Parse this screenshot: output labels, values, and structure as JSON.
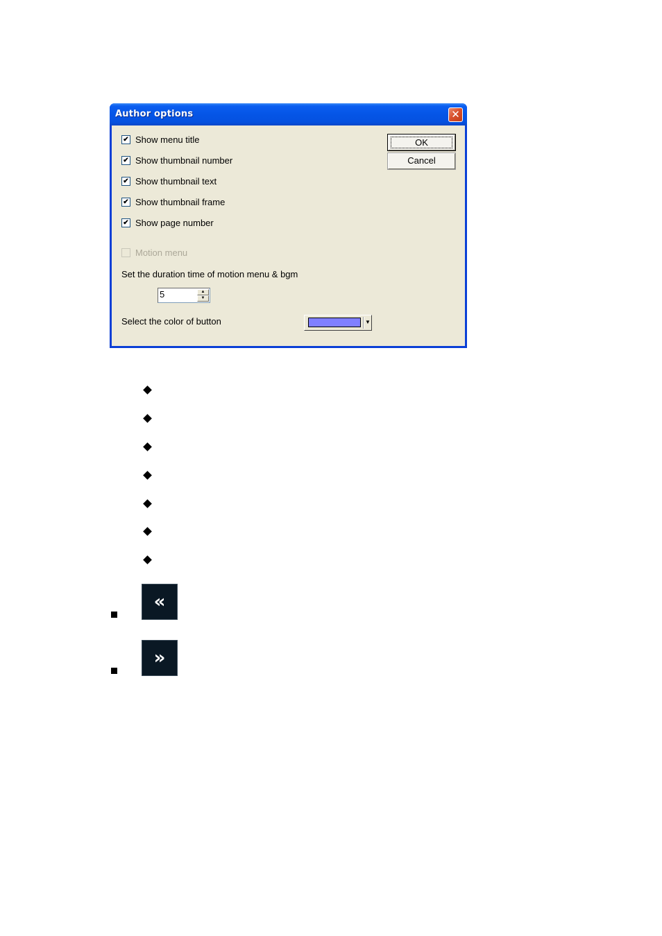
{
  "dialog": {
    "title": "Author options",
    "close_icon": "close-icon",
    "checkboxes": [
      {
        "label": "Show menu title",
        "checked": true,
        "enabled": true
      },
      {
        "label": "Show thumbnail number",
        "checked": true,
        "enabled": true
      },
      {
        "label": "Show thumbnail text",
        "checked": true,
        "enabled": true
      },
      {
        "label": "Show thumbnail frame",
        "checked": true,
        "enabled": true
      },
      {
        "label": "Show page number",
        "checked": true,
        "enabled": true
      },
      {
        "label": "Motion menu",
        "checked": false,
        "enabled": false
      }
    ],
    "check_mark": "✔",
    "ok_label": "OK",
    "cancel_label": "Cancel",
    "duration_label": "Set the duration time of motion menu & bgm",
    "duration_value": "5",
    "spin_up": "▲",
    "spin_down": "▼",
    "color_label": "Select the color of button",
    "button_color": "#8080ff",
    "color_dropdown_arrow": "▼"
  },
  "document": {
    "diamond_bullets": 7,
    "nav_buttons": [
      {
        "icon": "double-chevron-left-icon",
        "glyph": "«"
      },
      {
        "icon": "double-chevron-right-icon",
        "glyph": "»"
      }
    ]
  }
}
